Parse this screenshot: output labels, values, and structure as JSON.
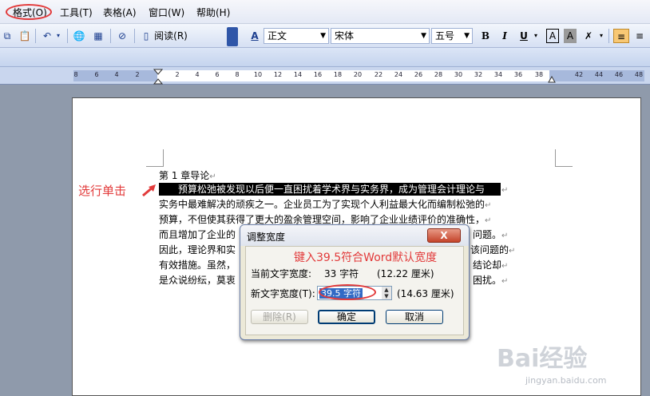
{
  "menubar": {
    "items": [
      "格式(O)",
      "工具(T)",
      "表格(A)",
      "窗口(W)",
      "帮助(H)"
    ]
  },
  "toolbar": {
    "read_label": "阅读(R)",
    "style_value": "正文",
    "font_value": "宋体",
    "size_value": "五号",
    "bold_label": "B",
    "italic_label": "I",
    "underline_label": "U",
    "char_border_label": "A",
    "char_shading_label": "A"
  },
  "ruler": {
    "ticks": [
      "8",
      "6",
      "4",
      "2",
      "2",
      "4",
      "6",
      "8",
      "10",
      "12",
      "14",
      "16",
      "18",
      "20",
      "22",
      "24",
      "26",
      "28",
      "30",
      "32",
      "34",
      "36",
      "38",
      "42",
      "44",
      "46",
      "48"
    ]
  },
  "document": {
    "heading": "第 1 章导论",
    "selected_line": "预算松弛被发现以后便一直困扰着学术界与实务界，成为管理会计理论与",
    "lines": [
      "实务中最难解决的顽疾之一。企业员工为了实现个人利益最大化而编制松弛的",
      "预算，不但使其获得了更大的盈余管理空间，影响了企业业绩评价的准确性，",
      "而且增加了企业的",
      "因此，理论界和实",
      "有效措施。虽然，",
      "是众说纷纭，莫衷"
    ],
    "right_fragments": [
      "问题。",
      "该问题的",
      "结论却",
      "困扰。"
    ],
    "para_mark": "↵"
  },
  "annotations": {
    "select_hint": "选行单击",
    "input_hint": "键入39.5符合Word默认宽度"
  },
  "dialog": {
    "title": "调整宽度",
    "close_label": "X",
    "current_label": "当前文字宽度:",
    "current_chars": "33 字符",
    "current_cm": "(12.22 厘米)",
    "new_label": "新文字宽度(T):",
    "new_value": "39.5 字符",
    "new_cm": "(14.63 厘米)",
    "delete_label": "删除(R)",
    "ok_label": "确定",
    "cancel_label": "取消"
  },
  "watermark": {
    "logo": "Bai经验",
    "url": "jingyan.baidu.com"
  },
  "colors": {
    "annotation_red": "#e23a3a",
    "selection": "#000000",
    "input_highlight": "#316ac5"
  }
}
